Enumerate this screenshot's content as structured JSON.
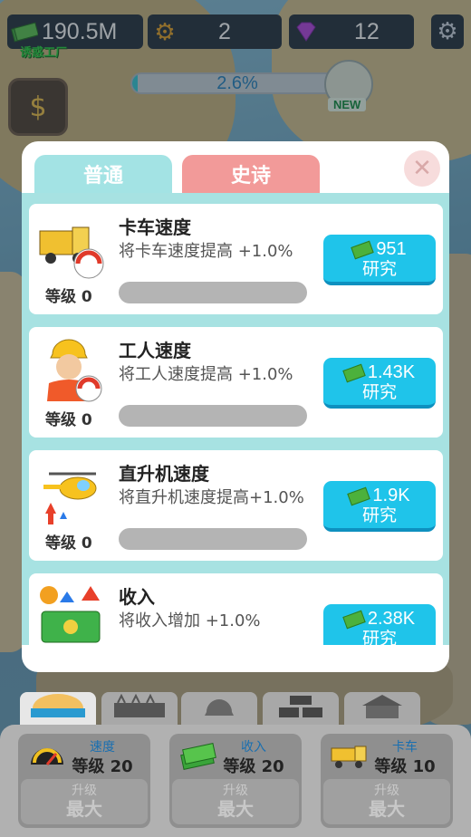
{
  "topbar": {
    "cash": "190.5M",
    "gears": "2",
    "gems": "12"
  },
  "logo_text": "诱惑工厂",
  "progress": {
    "label": "2.6%",
    "fraction": 0.026
  },
  "new_badge": "NEW",
  "tabs": {
    "normal": "普通",
    "epic": "史诗"
  },
  "cards": [
    {
      "title": "卡车速度",
      "desc": "将卡车速度提高 +1.0%",
      "level": "等级 0",
      "cost": "951",
      "button": "研究"
    },
    {
      "title": "工人速度",
      "desc": "将工人速度提高 +1.0%",
      "level": "等级 0",
      "cost": "1.43K",
      "button": "研究"
    },
    {
      "title": "直升机速度",
      "desc": "将直升机速度提高+1.0%",
      "level": "等级 0",
      "cost": "1.9K",
      "button": "研究"
    },
    {
      "title": "收入",
      "desc": "将收入增加 +1.0%",
      "level": "",
      "cost": "2.38K",
      "button": "研究"
    }
  ],
  "upgrades": [
    {
      "key": "速度",
      "level": "等级 20",
      "btn_top": "升级",
      "btn_main": "最大"
    },
    {
      "key": "收入",
      "level": "等级 20",
      "btn_top": "升级",
      "btn_main": "最大"
    },
    {
      "key": "卡车",
      "level": "等级 10",
      "btn_top": "升级",
      "btn_main": "最大"
    }
  ],
  "colors": {
    "accent": "#1fc4ea",
    "tab_normal": "#a3e3e4",
    "tab_epic": "#f29a99"
  }
}
